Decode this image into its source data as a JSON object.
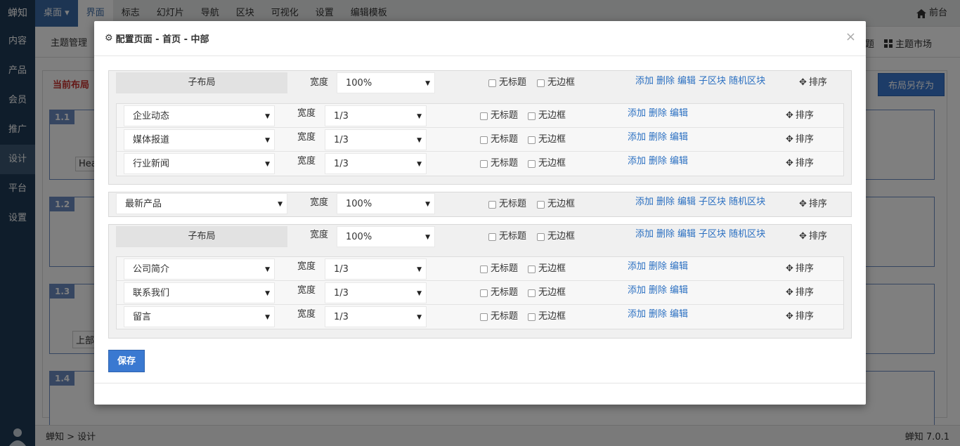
{
  "app": {
    "brand": "蝉知",
    "version": "蝉知 7.0.1"
  },
  "sidebar": {
    "items": [
      "内容",
      "产品",
      "会员",
      "推广",
      "设计",
      "平台",
      "设置"
    ],
    "active_index": 4
  },
  "topnav": {
    "items": [
      "桌面 ▾",
      "界面",
      "标志",
      "幻灯片",
      "导航",
      "区块",
      "可视化",
      "设置",
      "编辑模板"
    ],
    "front": "前台"
  },
  "subbar": {
    "items": [
      "主题管理"
    ],
    "theme_market": "主题市场",
    "partial_right": "题"
  },
  "background": {
    "current_layout": "当前布局",
    "save_layout": "布局另存为",
    "blocks": [
      {
        "tag": "1.1",
        "text": "Hea"
      },
      {
        "tag": "1.2",
        "text": ""
      },
      {
        "tag": "1.3",
        "text": "上部"
      },
      {
        "tag": "1.4",
        "text": ""
      }
    ]
  },
  "footer": {
    "breadcrumb": "蝉知 > 设计"
  },
  "modal": {
    "title": "配置页面 - 首页 - 中部",
    "close": "×",
    "width_label": "宽度",
    "no_title": "无标题",
    "no_border": "无边框",
    "sort": "排序",
    "link_add": "添加",
    "link_delete": "删除",
    "link_edit": "编辑",
    "link_subblock": "子区块",
    "link_random": "随机区块",
    "save": "保存",
    "groups": [
      {
        "name": "子布局",
        "width": "100%",
        "children": [
          {
            "name": "企业动态",
            "width": "1/3"
          },
          {
            "name": "媒体报道",
            "width": "1/3"
          },
          {
            "name": "行业新闻",
            "width": "1/3"
          }
        ]
      },
      {
        "name": "最新产品",
        "width": "100%",
        "children": []
      },
      {
        "name": "子布局",
        "width": "100%",
        "children": [
          {
            "name": "公司简介",
            "width": "1/3"
          },
          {
            "name": "联系我们",
            "width": "1/3"
          },
          {
            "name": "留言",
            "width": "1/3"
          }
        ]
      }
    ]
  }
}
